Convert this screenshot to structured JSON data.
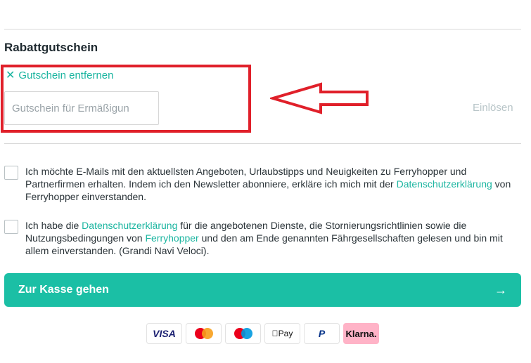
{
  "coupon": {
    "title": "Rabattgutschein",
    "remove_label": "Gutschein entfernen",
    "remove_icon": "close-icon",
    "placeholder": "Gutschein für Ermäßigun",
    "redeem_label": "Einlösen"
  },
  "consents": [
    {
      "text_before": "Ich möchte E-Mails mit den aktuellsten Angeboten, Urlaubstipps und Neuigkeiten zu Ferryhopper und Partnerfirmen erhalten. Indem ich den Newsletter abonniere, erkläre ich mich mit der ",
      "link": "Datenschutzerklärung",
      "text_after": " von Ferryhopper einverstanden."
    },
    {
      "text_before": "Ich habe die ",
      "link": "Datenschutzerklärung",
      "text_middle": " für die angebotenen Dienste, die Stornierungsrichtlinien sowie die Nutzungsbedingungen von ",
      "link2": "Ferryhopper",
      "text_after": " und den am Ende genannten Fährgesellschaften gelesen und bin mit allem einverstanden. (Grandi Navi Veloci)."
    }
  ],
  "checkout": {
    "label": "Zur Kasse gehen",
    "arrow": "→"
  },
  "payments": {
    "visa": "VISA",
    "applepay": " Pay",
    "paypal": "P",
    "klarna": "Klarna."
  },
  "colors": {
    "accent": "#1bbfa5",
    "link": "#1bb5a0",
    "highlight": "#e0202a",
    "klarna": "#ffb3c7",
    "mastercard_red": "#eb001b",
    "mastercard_orange": "#f79e1b",
    "maestro_red": "#eb001b",
    "maestro_blue": "#0099df"
  }
}
